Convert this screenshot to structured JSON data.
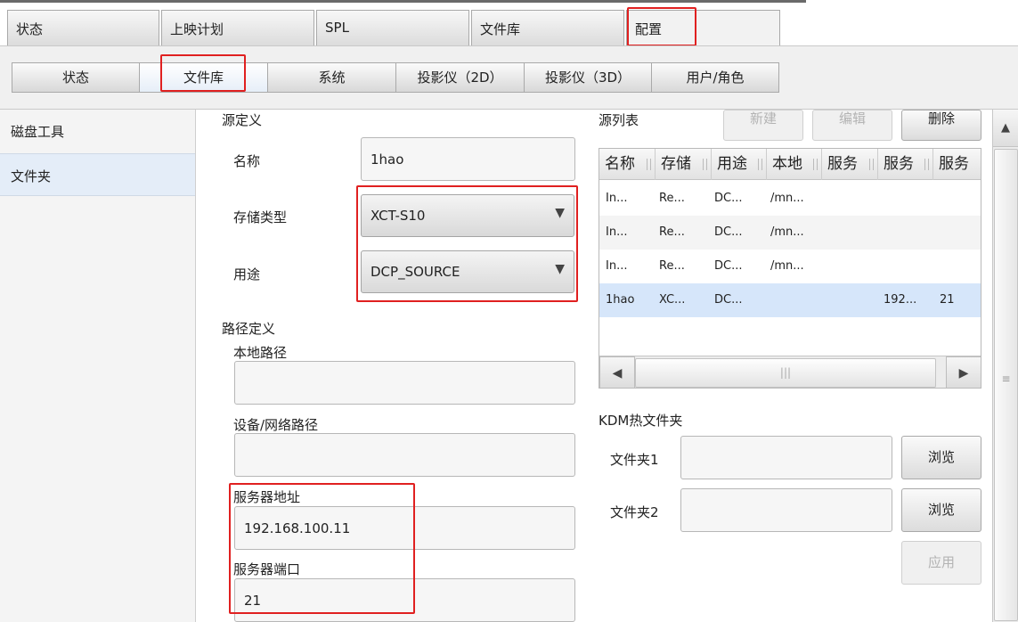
{
  "top_tabs": [
    "状态",
    "上映计划",
    "SPL",
    "文件库",
    "配置"
  ],
  "sub_tabs": [
    "状态",
    "文件库",
    "系统",
    "投影仪（2D）",
    "投影仪（3D）",
    "用户/角色"
  ],
  "left_nav": [
    "磁盘工具",
    "文件夹"
  ],
  "source_def": {
    "section_title": "源定义",
    "name_label": "名称",
    "name_value": "1hao",
    "storage_type_label": "存储类型",
    "storage_type_value": "XCT-S10",
    "usage_label": "用途",
    "usage_value": "DCP_SOURCE"
  },
  "path_def": {
    "section_title": "路径定义",
    "local_path_label": "本地路径",
    "local_path_value": "",
    "device_path_label": "设备/网络路径",
    "device_path_value": "",
    "server_addr_label": "服务器地址",
    "server_addr_value": "192.168.100.11",
    "server_port_label": "服务器端口",
    "server_port_value": "21"
  },
  "source_list": {
    "title": "源列表",
    "new_button": "新建",
    "edit_button": "编辑",
    "delete_button": "删除",
    "columns": [
      "名称",
      "存储",
      "用途",
      "本地",
      "服务",
      "服务",
      "服务"
    ],
    "rows": [
      [
        "In...",
        "Re...",
        "DC...",
        "/mn...",
        "",
        "",
        ""
      ],
      [
        "In...",
        "Re...",
        "DC...",
        "/mn...",
        "",
        "",
        ""
      ],
      [
        "In...",
        "Re...",
        "DC...",
        "/mn...",
        "",
        "",
        ""
      ],
      [
        "1hao",
        "XC...",
        "DC...",
        "",
        "",
        "192...",
        "21"
      ]
    ],
    "selected_row": 3
  },
  "kdm": {
    "title": "KDM热文件夹",
    "folder1_label": "文件夹1",
    "folder1_value": "",
    "folder2_label": "文件夹2",
    "folder2_value": "",
    "browse1_button": "浏览",
    "browse2_button": "浏览",
    "apply_button": "应用"
  },
  "icons": {
    "dropdown": "▼",
    "scroll_left": "◀",
    "scroll_right": "▶",
    "scroll_up": "▲",
    "grip_h": "|||",
    "grip_v": "≡"
  },
  "colors": {
    "highlight_box": "#e02020",
    "selected_row": "#d6e6fa"
  }
}
